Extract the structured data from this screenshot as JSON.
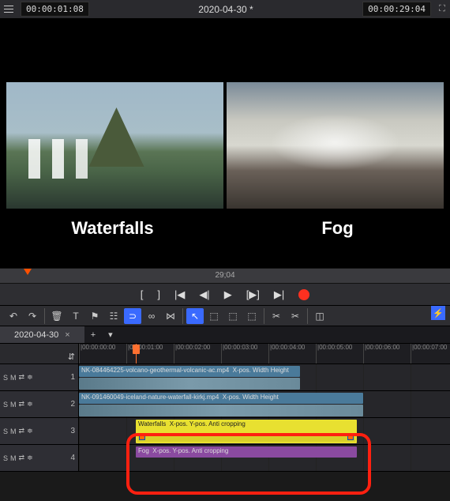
{
  "topbar": {
    "tc_in": "00:00:01:08",
    "title": "2020-04-30 *",
    "tc_out": "00:00:29:04"
  },
  "preview": {
    "label_left": "Waterfalls",
    "label_right": "Fog"
  },
  "ruler": {
    "duration": "29;04"
  },
  "transport": {
    "start": "[",
    "end": "]",
    "prev": "|◀",
    "stepb": "◀|",
    "play": "▶",
    "stepf": "[▶]",
    "next": "▶|"
  },
  "tab": {
    "name": "2020-04-30",
    "close": "×",
    "add": "+",
    "more": "▾"
  },
  "timecodes": [
    "|00:00:00:00",
    "|00:00:01:00",
    "|00:00:02:00",
    "|00:00:03:00",
    "|00:00:04:00",
    "|00:00:05:00",
    "|00:00:06:00",
    "|00:00:07:00"
  ],
  "track_head": {
    "s": "S",
    "m": "M",
    "link": "⇄",
    "lock": "≑"
  },
  "tracks": {
    "1": {
      "n": "1",
      "clip": "NK-084464225-volcano-geothermal-volcanic-ac.mp4",
      "props": "X-pos. Width Height"
    },
    "2": {
      "n": "2",
      "clip": "NK-091460049-iceland-nature-waterfall-kirkj.mp4",
      "props": "X-pos. Width Height"
    },
    "3": {
      "n": "3",
      "clip": "Waterfalls",
      "props": "X-pos. Y-pos. Anti cropping"
    },
    "4": {
      "n": "4",
      "clip": "Fog",
      "props": "X-pos. Y-pos. Anti cropping"
    }
  }
}
